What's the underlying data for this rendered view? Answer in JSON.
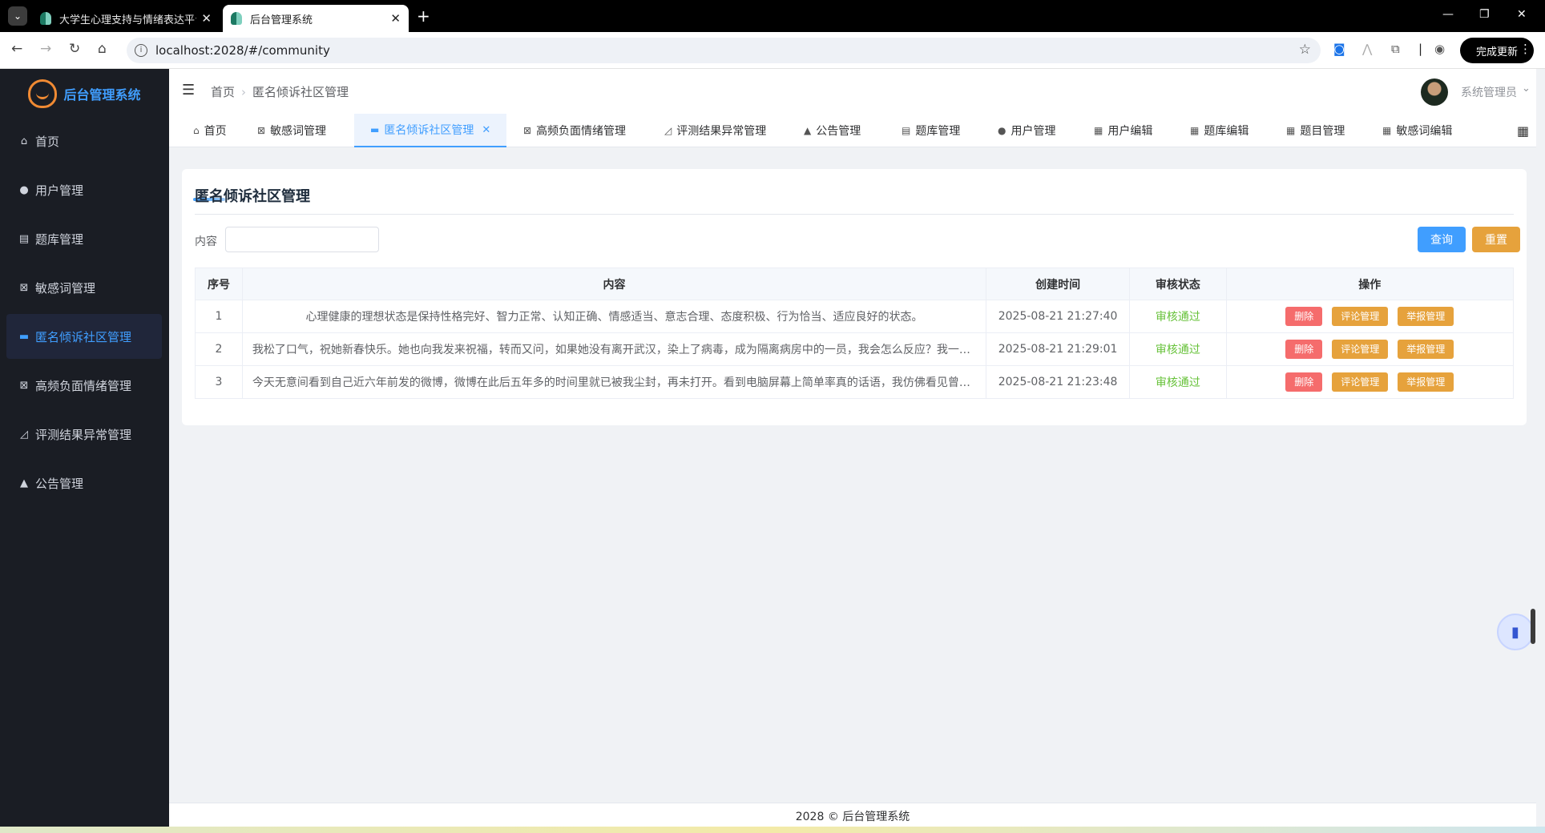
{
  "browser": {
    "tabs": [
      {
        "title": "大学生心理支持与情绪表达平台",
        "active": false
      },
      {
        "title": "后台管理系统",
        "active": true
      }
    ],
    "url": "localhost:2028/#/community",
    "update_label": "完成更新"
  },
  "app": {
    "title": "后台管理系统"
  },
  "sidebar": {
    "items": [
      {
        "label": "首页",
        "icon": "home-icon"
      },
      {
        "label": "用户管理",
        "icon": "user-icon"
      },
      {
        "label": "题库管理",
        "icon": "clipboard-icon"
      },
      {
        "label": "敏感词管理",
        "icon": "calendar-x-icon"
      },
      {
        "label": "匿名倾诉社区管理",
        "icon": "chat-icon",
        "active": true
      },
      {
        "label": "高频负面情绪管理",
        "icon": "calendar-x-icon"
      },
      {
        "label": "评测结果异常管理",
        "icon": "chart-icon"
      },
      {
        "label": "公告管理",
        "icon": "bell-icon"
      }
    ]
  },
  "header": {
    "breadcrumb": [
      "首页",
      "匿名倾诉社区管理"
    ],
    "username": "系统管理员"
  },
  "tags": [
    {
      "label": "首页",
      "icon": "home-icon"
    },
    {
      "label": "敏感词管理",
      "icon": "calendar-x-icon"
    },
    {
      "label": "匿名倾诉社区管理",
      "icon": "chat-icon",
      "active": true
    },
    {
      "label": "高频负面情绪管理",
      "icon": "calendar-x-icon"
    },
    {
      "label": "评测结果异常管理",
      "icon": "chart-icon"
    },
    {
      "label": "公告管理",
      "icon": "bell-icon"
    },
    {
      "label": "题库管理",
      "icon": "clipboard-icon"
    },
    {
      "label": "用户管理",
      "icon": "user-icon"
    },
    {
      "label": "用户编辑",
      "icon": "grid-icon"
    },
    {
      "label": "题库编辑",
      "icon": "grid-icon"
    },
    {
      "label": "题目管理",
      "icon": "grid-icon"
    },
    {
      "label": "敏感词编辑",
      "icon": "grid-icon"
    }
  ],
  "page": {
    "title": "匿名倾诉社区管理",
    "filter": {
      "label": "内容",
      "value": ""
    },
    "query_label": "查询",
    "reset_label": "重置"
  },
  "table": {
    "columns": [
      "序号",
      "内容",
      "创建时间",
      "审核状态",
      "操作"
    ],
    "rows": [
      {
        "index": "1",
        "content": "心理健康的理想状态是保持性格完好、智力正常、认知正确、情感适当、意志合理、态度积极、行为恰当、适应良好的状态。",
        "created": "2025-08-21 21:27:40",
        "status": "审核通过"
      },
      {
        "index": "2",
        "content": "我松了口气，祝她新春快乐。她也向我发来祝福，转而又问，如果她没有离开武汉，染上了病毒，成为隔离病房中的一员，我会怎么反应？我一…",
        "created": "2025-08-21 21:29:01",
        "status": "审核通过"
      },
      {
        "index": "3",
        "content": "今天无意间看到自己近六年前发的微博，微博在此后五年多的时间里就已被我尘封，再未打开。看到电脑屏幕上简单率真的话语，我仿佛看见曾…",
        "created": "2025-08-21 21:23:48",
        "status": "审核通过"
      }
    ],
    "actions": {
      "delete": "删除",
      "comments": "评论管理",
      "reports": "举报管理"
    }
  },
  "footer": {
    "text": "2028 © 后台管理系统"
  },
  "colors": {
    "primary": "#409eff",
    "warning": "#e6a23c",
    "danger": "#f56c6c",
    "success": "#67c23a",
    "sidebar_bg": "#1a1d24"
  }
}
